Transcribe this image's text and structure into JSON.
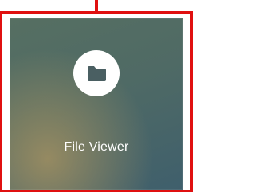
{
  "tile": {
    "label": "File Viewer",
    "icon": "folder-icon",
    "highlighted": true
  },
  "colors": {
    "highlight": "#e01010",
    "tile_dark": "#3f5f6c",
    "tile_warm": "#af965f",
    "icon_bg": "#ffffff",
    "icon_fg": "#4a5f62"
  }
}
